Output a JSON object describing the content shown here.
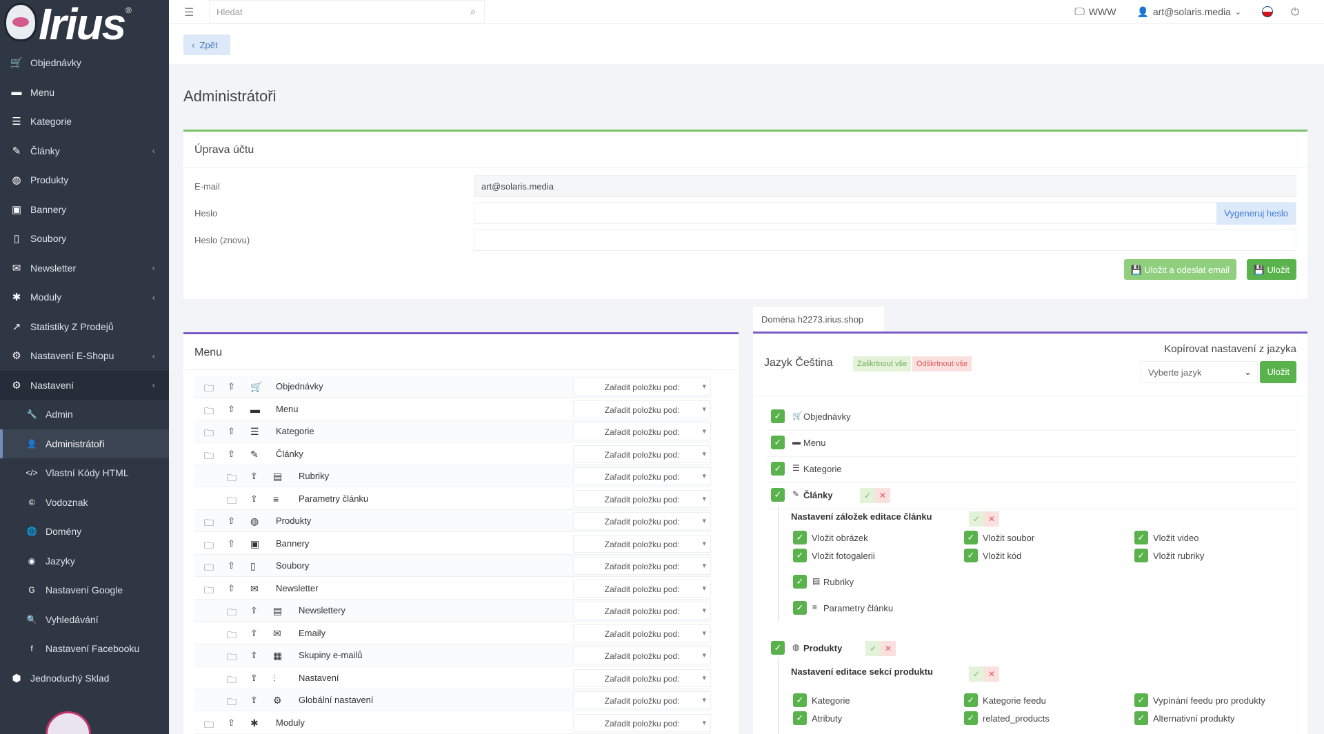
{
  "app": {
    "logo_text": "Irius",
    "logo_mark": "®"
  },
  "sidebar": {
    "items": [
      {
        "label": "Objednávky",
        "icon": "cart-icon",
        "glyph": "🛒"
      },
      {
        "label": "Menu",
        "icon": "folder-icon",
        "glyph": "▬"
      },
      {
        "label": "Kategorie",
        "icon": "list-icon",
        "glyph": "☰"
      },
      {
        "label": "Články",
        "icon": "pencil-icon",
        "glyph": "✎"
      },
      {
        "label": "Produkty",
        "icon": "basketball-icon",
        "glyph": "◍"
      },
      {
        "label": "Bannery",
        "icon": "image-icon",
        "glyph": "▣"
      },
      {
        "label": "Soubory",
        "icon": "file-icon",
        "glyph": "▯"
      },
      {
        "label": "Newsletter",
        "icon": "mail-icon",
        "glyph": "✉"
      },
      {
        "label": "Moduly",
        "icon": "puzzle-icon",
        "glyph": "✱"
      },
      {
        "label": "Statistiky Z Prodejů",
        "icon": "chart-line-icon",
        "glyph": "↗"
      },
      {
        "label": "Nastavení E-Shopu",
        "icon": "cogs-icon",
        "glyph": "⚙"
      },
      {
        "label": "Nastavení",
        "icon": "cogs-icon",
        "glyph": "⚙"
      }
    ],
    "sub_items": [
      {
        "label": "Admin",
        "icon": "wrench-icon",
        "glyph": "🔧"
      },
      {
        "label": "Administrátoři",
        "icon": "user-icon",
        "glyph": "👤"
      },
      {
        "label": "Vlastní Kódy HTML",
        "icon": "html-icon",
        "glyph": "</>"
      },
      {
        "label": "Vodoznak",
        "icon": "copyright-icon",
        "glyph": "©"
      },
      {
        "label": "Domény",
        "icon": "globe-icon",
        "glyph": "🌐"
      },
      {
        "label": "Jazyky",
        "icon": "language-icon",
        "glyph": "◉"
      },
      {
        "label": "Nastavení Google",
        "icon": "google-icon",
        "glyph": "G"
      },
      {
        "label": "Vyhledávání",
        "icon": "search-icon",
        "glyph": "🔍"
      },
      {
        "label": "Nastavení Facebooku",
        "icon": "facebook-icon",
        "glyph": "f"
      }
    ],
    "last_item": {
      "label": "Jednoduchý Sklad",
      "icon": "cubes-icon",
      "glyph": "⬢"
    }
  },
  "topbar": {
    "search_placeholder": "Hledat",
    "www_label": "WWW",
    "user_label": "art@solaris.media"
  },
  "page": {
    "back_label": "Zpět",
    "title": "Administrátoři"
  },
  "account": {
    "title": "Úprava účtu",
    "email_label": "E-mail",
    "email_value": "art@solaris.media",
    "password_label": "Heslo",
    "password_again_label": "Heslo (znovu)",
    "generate_label": "Vygeneruj heslo",
    "save_send_label": "Uložit a odeslat email",
    "save_label": "Uložit"
  },
  "menu_panel": {
    "title": "Menu",
    "assign_label": "Zařadit položku pod:",
    "rows": [
      {
        "label": "Objednávky",
        "indent": 0,
        "glyph": "🛒"
      },
      {
        "label": "Menu",
        "indent": 0,
        "glyph": "▬"
      },
      {
        "label": "Kategorie",
        "indent": 0,
        "glyph": "☰"
      },
      {
        "label": "Články",
        "indent": 0,
        "glyph": "✎"
      },
      {
        "label": "Rubriky",
        "indent": 1,
        "glyph": "▤"
      },
      {
        "label": "Parametry článku",
        "indent": 1,
        "glyph": "≡"
      },
      {
        "label": "Produkty",
        "indent": 0,
        "glyph": "◍"
      },
      {
        "label": "Bannery",
        "indent": 0,
        "glyph": "▣"
      },
      {
        "label": "Soubory",
        "indent": 0,
        "glyph": "▯"
      },
      {
        "label": "Newsletter",
        "indent": 0,
        "glyph": "✉"
      },
      {
        "label": "Newslettery",
        "indent": 1,
        "glyph": "▤"
      },
      {
        "label": "Emaily",
        "indent": 1,
        "glyph": "✉"
      },
      {
        "label": "Skupiny e-mailů",
        "indent": 1,
        "glyph": "▦"
      },
      {
        "label": "Nastavení",
        "indent": 1,
        "glyph": "⫶"
      },
      {
        "label": "Globální nastavení",
        "indent": 1,
        "glyph": "⚙"
      },
      {
        "label": "Moduly",
        "indent": 0,
        "glyph": "✱"
      }
    ]
  },
  "perm_panel": {
    "domain_tab": "Doména h2273.irius.shop",
    "lang_title": "Jazyk Čeština",
    "check_all": "Zaškrtnout vše",
    "uncheck_all": "Odškrtnout vše",
    "copy_title": "Kopírovat nastavení z jazyka",
    "copy_select": "Vyberte jazyk",
    "copy_save": "Uložit",
    "items": [
      "Objednávky",
      "Menu",
      "Kategorie",
      "Články"
    ],
    "item_glyphs": [
      "🛒",
      "▬",
      "☰",
      "✎"
    ],
    "clanky_tabs_title": "Nastavení záložek editace článku",
    "clanky_options": [
      "Vložit obrázek",
      "Vložit soubor",
      "Vložit video",
      "Vložit fotogalerii",
      "Vložit kód",
      "Vložit rubriky"
    ],
    "clanky_children": [
      "Rubriky",
      "Parametry článku"
    ],
    "produkty": "Produkty",
    "produkty_sections_title": "Nastavení editace sekcí produktu",
    "produkty_options": [
      "Kategorie",
      "Kategorie feedu",
      "Vypínání feedu pro produkty",
      "Atributy",
      "related_products",
      "Alternativní produkty"
    ]
  },
  "colors": {
    "sidebar": "#2f3744",
    "green": "#5ab24d",
    "accent_green": "#7cc36b",
    "purple": "#7a5bc9",
    "blue": "#4a78c4"
  }
}
